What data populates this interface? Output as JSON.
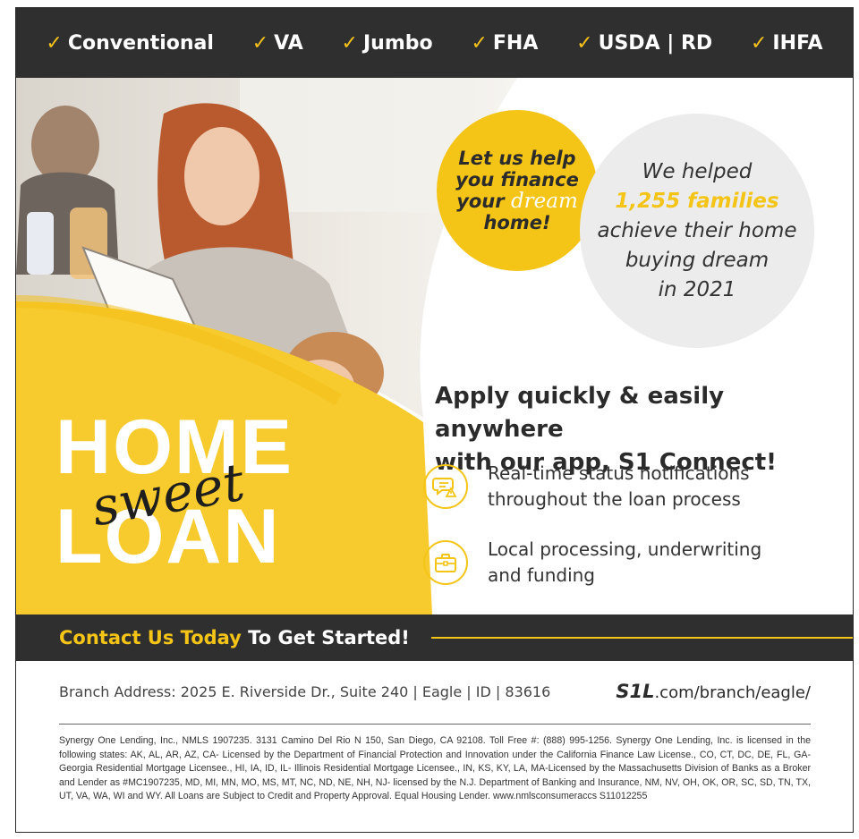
{
  "loan_types": [
    "Conventional",
    "VA",
    "Jumbo",
    "FHA",
    "USDA | RD",
    "IHFA"
  ],
  "yellow_circle": {
    "line1": "Let us help",
    "line2": "you finance",
    "line3_prefix": "your",
    "line3_script": "dream",
    "line4": "home!"
  },
  "gray_circle": {
    "line1": "We helped",
    "highlight": "1,255 families",
    "line3": "achieve their home",
    "line4": "buying dream",
    "line5": "in 2021"
  },
  "apply": {
    "line1": "Apply quickly & easily anywhere",
    "line2": "with our app, S1 Connect!"
  },
  "features": [
    {
      "icon": "chat-alert-icon",
      "line1": "Real-time status notifications",
      "line2": "throughout the loan process"
    },
    {
      "icon": "briefcase-icon",
      "line1": "Local processing, underwriting",
      "line2": "and funding"
    }
  ],
  "hero_title": {
    "top": "HOME",
    "script": "sweet",
    "bottom": "LOAN"
  },
  "contact": {
    "highlight": "Contact Us Today",
    "rest": " To Get Started!"
  },
  "address": "Branch Address: 2025 E. Riverside Dr., Suite 240 | Eagle | ID | 83616",
  "url": {
    "logo": "S1L",
    "rest": ".com/branch/eagle/"
  },
  "disclaimer": "Synergy One Lending, Inc., NMLS 1907235. 3131 Camino Del Rio N 150, San Diego, CA 92108. Toll Free #: (888) 995-1256. Synergy One Lending, Inc. is licensed in the following states: AK, AL, AR, AZ, CA- Licensed by the Department of Financial Protection and Innovation under the California Finance Law License., CO, CT, DC, DE, FL, GA- Georgia Residential Mortgage Licensee., HI, IA, ID, IL- Illinois Residential Mortgage Licensee., IN, KS, KY, LA, MA-Licensed by the Massachusetts Division of Banks as a Broker and Lender as #MC1907235, MD, MI, MN, MO, MS, MT, NC, ND, NE, NH, NJ- licensed by the N.J. Department of Banking and Insurance, NM, NV, OH, OK, OR, SC, SD, TN, TX, UT, VA, WA, WI and WY. All Loans are Subject to Credit and Property Approval. Equal Housing Lender. www.nmlsconsumeraccs S11012255",
  "colors": {
    "accent": "#f4c417",
    "dark": "#2f2f2f",
    "gray_circle": "#ececec"
  }
}
